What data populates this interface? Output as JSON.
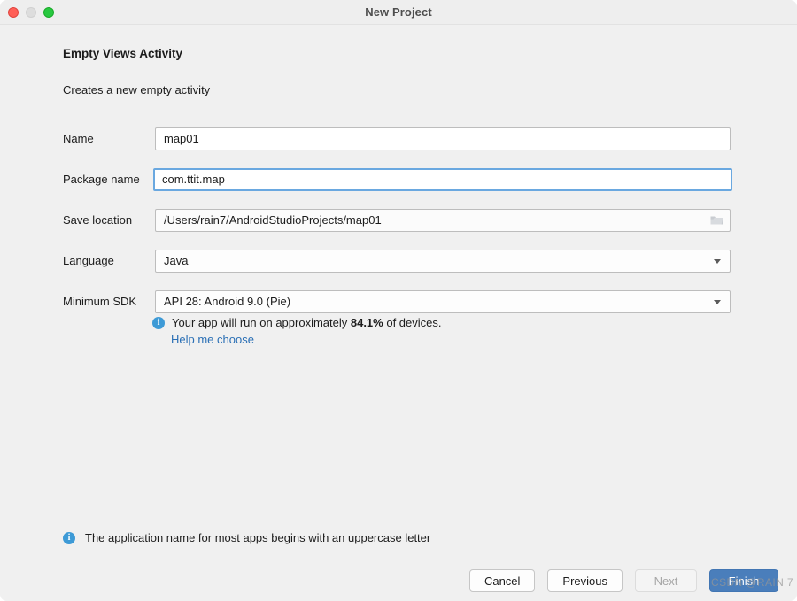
{
  "window": {
    "title": "New Project",
    "traffic_lights": [
      "close",
      "minimize",
      "maximize"
    ]
  },
  "template": {
    "name": "Empty Views Activity",
    "description": "Creates a new empty activity"
  },
  "form": {
    "fields": [
      {
        "label": "Name",
        "value": "map01",
        "type": "text",
        "focused": false
      },
      {
        "label": "Package name",
        "value": "com.ttit.map",
        "type": "text",
        "focused": true
      },
      {
        "label": "Save location",
        "value": "/Users/rain7/AndroidStudioProjects/map01",
        "type": "path",
        "focused": false
      },
      {
        "label": "Language",
        "value": "Java",
        "type": "combo",
        "focused": false
      },
      {
        "label": "Minimum SDK",
        "value": "API 28: Android 9.0 (Pie)",
        "type": "combo",
        "focused": false
      }
    ]
  },
  "sdk_info": {
    "text_before": "Your app will run on approximately ",
    "percent": "84.1%",
    "text_after": " of devices.",
    "help_link": "Help me choose"
  },
  "bottom_notice": {
    "text": "The application name for most apps begins with an uppercase letter"
  },
  "footer": {
    "buttons": [
      {
        "label": "Cancel",
        "state": "enabled",
        "primary": false
      },
      {
        "label": "Previous",
        "state": "enabled",
        "primary": false
      },
      {
        "label": "Next",
        "state": "disabled",
        "primary": false
      },
      {
        "label": "Finish",
        "state": "enabled",
        "primary": true
      }
    ]
  },
  "watermark": {
    "text": "CSDN @RAIN 7"
  },
  "colors": {
    "accent": "#4a7ebb",
    "link": "#2a6fb5",
    "info_icon": "#3d9ad6",
    "focus_border": "#6aa8e0",
    "background": "#f0f0f0"
  }
}
